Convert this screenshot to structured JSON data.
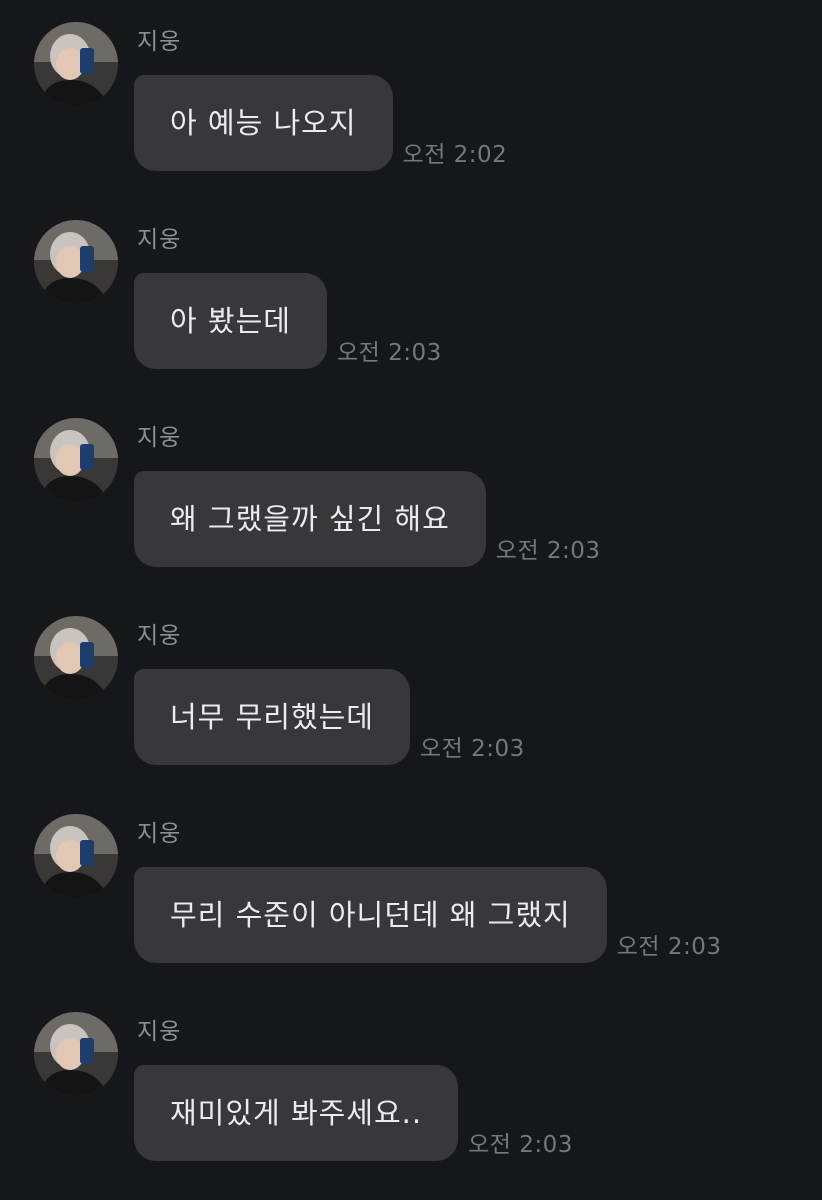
{
  "sender": {
    "name": "지웅"
  },
  "messages": [
    {
      "text": "아 예능 나오지",
      "time": "오전 2:02"
    },
    {
      "text": "아 봤는데",
      "time": "오전 2:03"
    },
    {
      "text": "왜 그랬을까 싶긴 해요",
      "time": "오전 2:03"
    },
    {
      "text": "너무 무리했는데",
      "time": "오전 2:03"
    },
    {
      "text": "무리 수준이 아니던데 왜 그랬지",
      "time": "오전 2:03"
    },
    {
      "text": "재미있게 봐주세요..",
      "time": "오전 2:03"
    }
  ],
  "colors": {
    "background": "#16171b",
    "bubble": "#38383c",
    "text": "#ececee",
    "meta": "#76777b"
  }
}
